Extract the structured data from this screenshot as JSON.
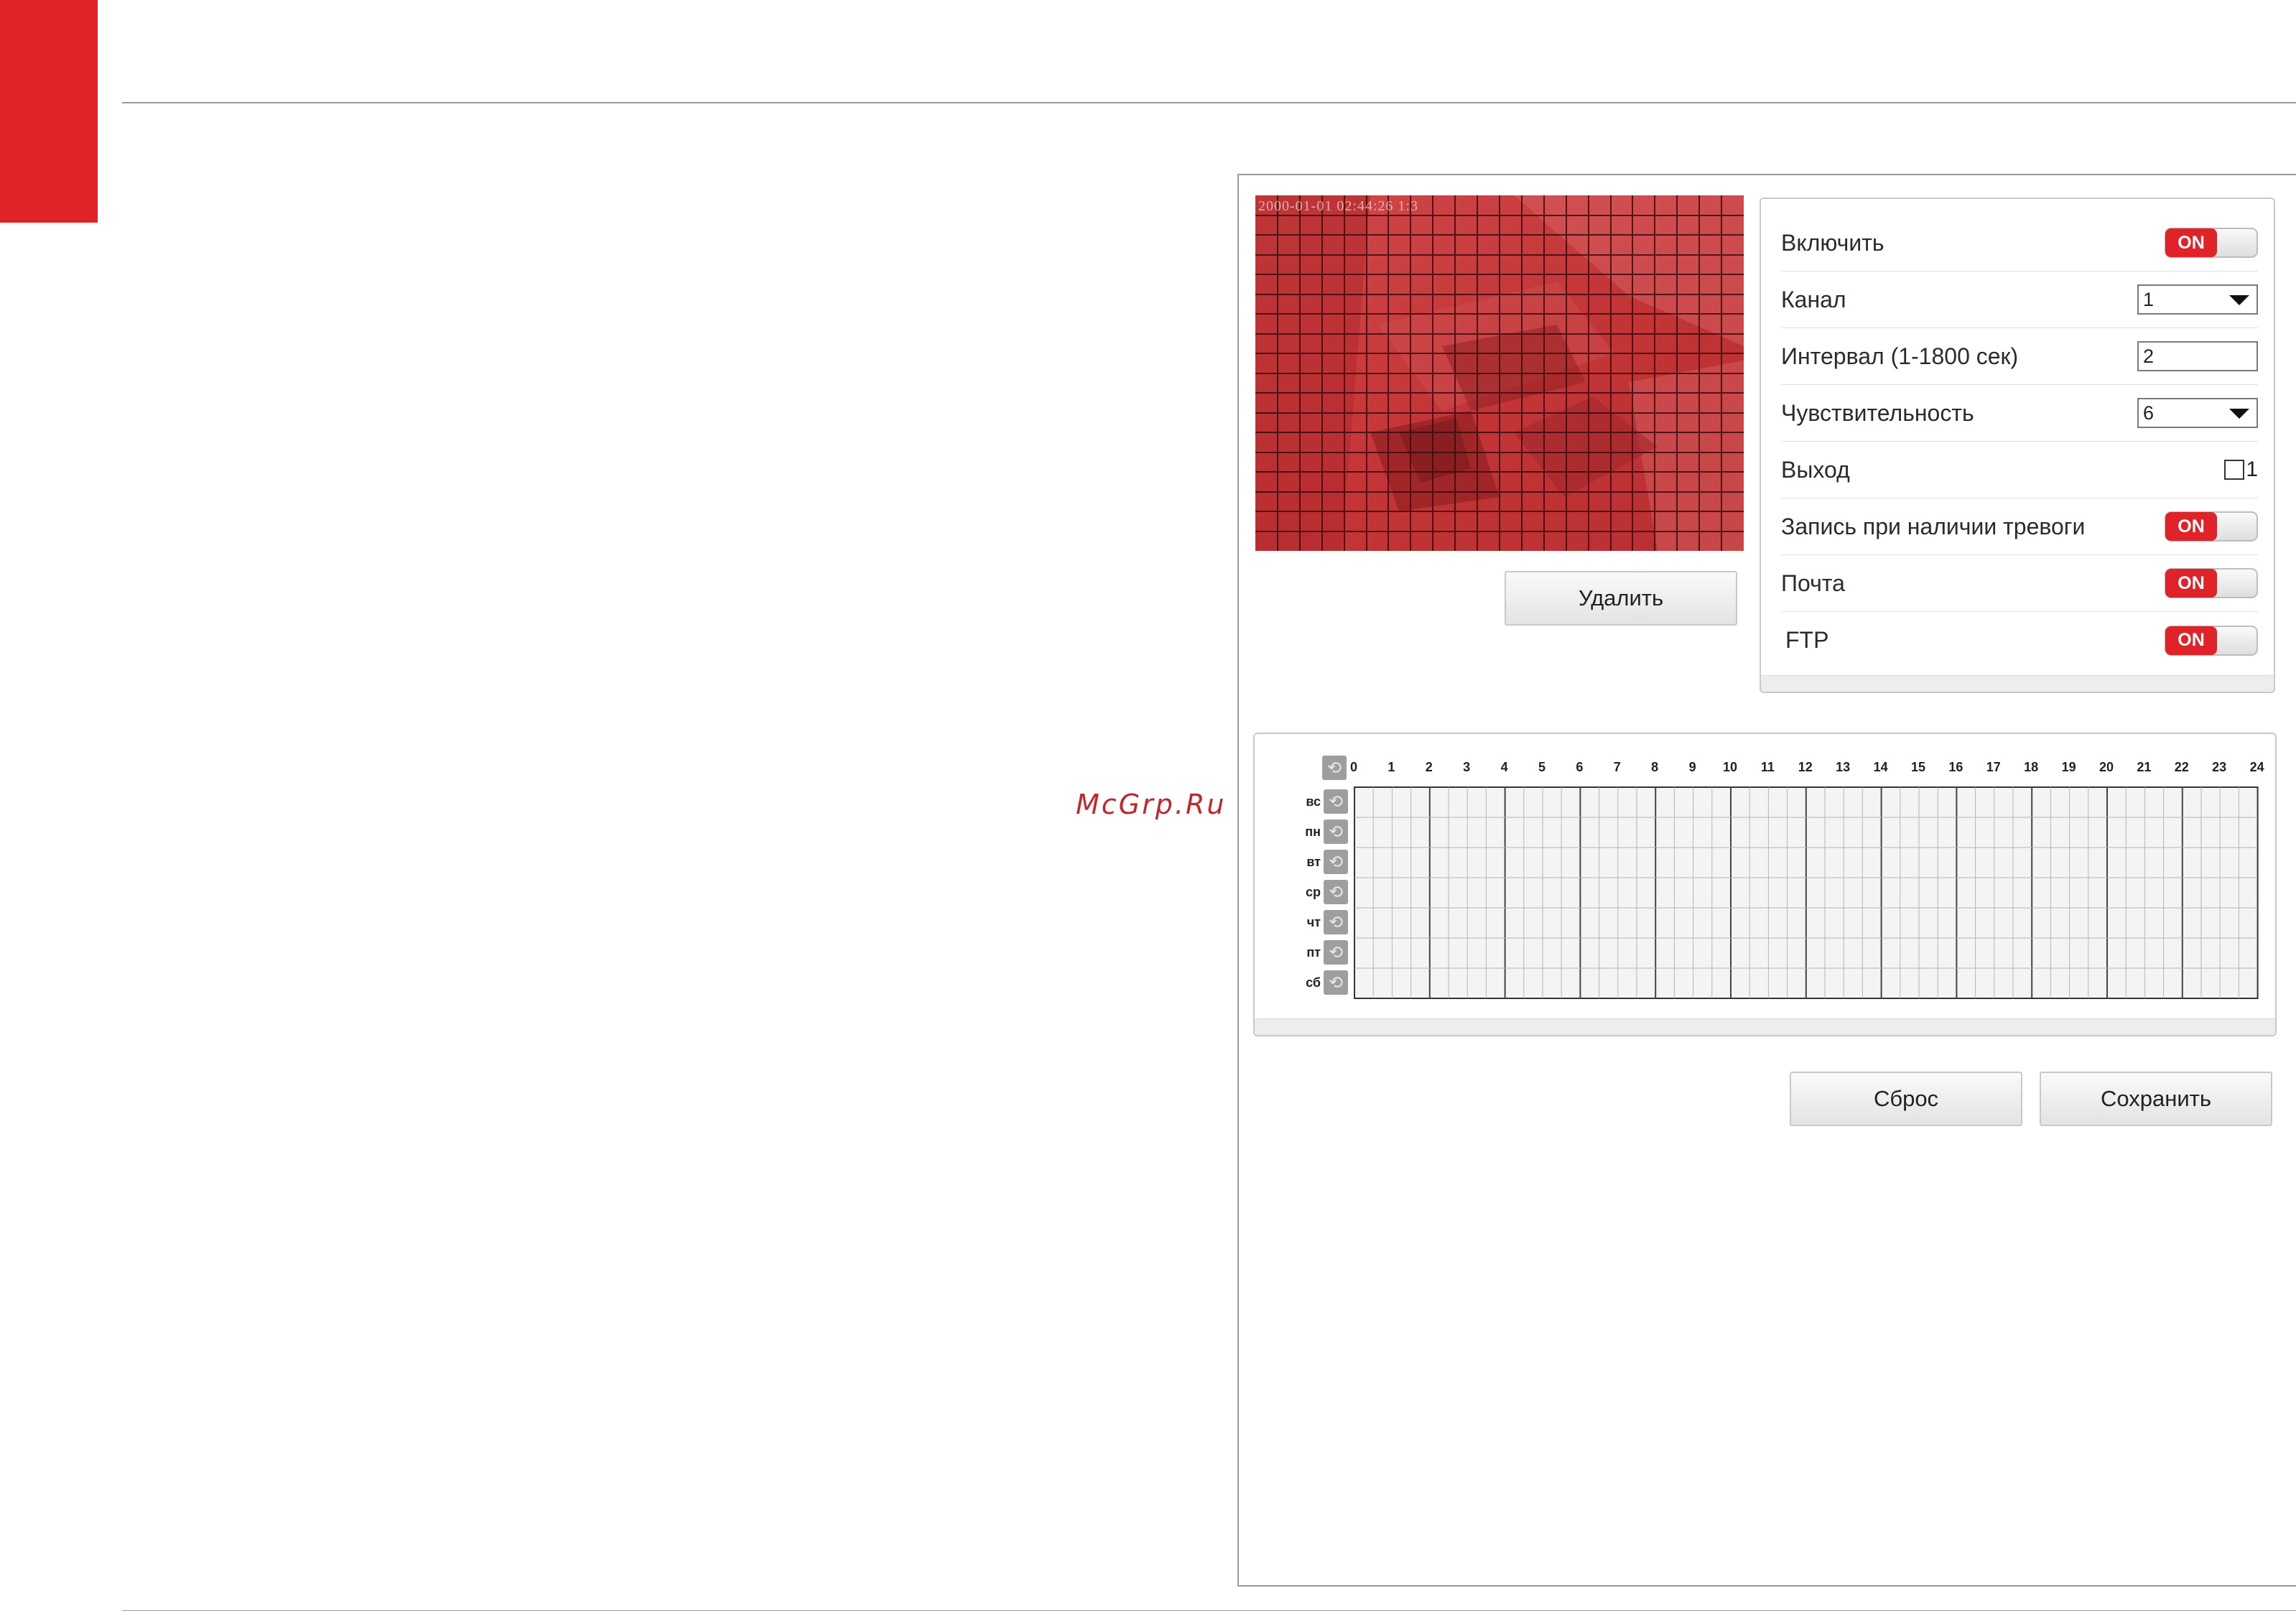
{
  "colors": {
    "accent": "#e02329",
    "mask": "#c7393c"
  },
  "preview": {
    "timestamp": "2000-01-01 02:44:26 1:3",
    "delete_label": "Удалить"
  },
  "settings": {
    "enable": {
      "label": "Включить",
      "toggle": "ON"
    },
    "channel": {
      "label": "Канал",
      "value": "1"
    },
    "interval": {
      "label": "Интервал (1-1800 сек)",
      "value": "2"
    },
    "sensitivity": {
      "label": "Чувствительность",
      "value": "6"
    },
    "output": {
      "label": "Выход",
      "checkbox_label": "1",
      "checked": false
    },
    "alarm_record": {
      "label": "Запись при наличии тревоги",
      "toggle": "ON"
    },
    "mail": {
      "label": "Почта",
      "toggle": "ON"
    },
    "ftp": {
      "label": "FTP",
      "toggle": "ON"
    }
  },
  "schedule": {
    "days": [
      "ВС",
      "ПН",
      "ВТ",
      "СР",
      "ЧТ",
      "ПТ",
      "СБ"
    ],
    "hours": [
      "0",
      "1",
      "2",
      "3",
      "4",
      "5",
      "6",
      "7",
      "8",
      "9",
      "10",
      "11",
      "12",
      "13",
      "14",
      "15",
      "16",
      "17",
      "18",
      "19",
      "20",
      "21",
      "22",
      "23",
      "24"
    ]
  },
  "actions": {
    "reset_label": "Сброс",
    "save_label": "Сохранить"
  },
  "watermark": "McGrp.Ru"
}
